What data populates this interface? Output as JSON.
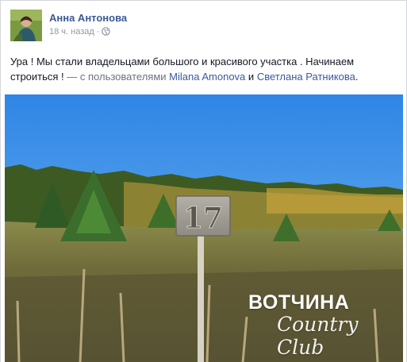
{
  "post": {
    "author": "Анна Антонова",
    "time": "18 ч. назад",
    "privacy_icon": "globe-icon",
    "message": "Ура ! Мы стали владельцами большого и красивого участка . Начинаем строиться !",
    "with_prefix": "— с пользователями",
    "tagged": [
      "Milana Amonova",
      "Светлана Ратникова"
    ],
    "conjunction": "и",
    "end_punct": "."
  },
  "photo": {
    "sign_number": "17",
    "watermark_title": "ВОТЧИНА",
    "watermark_subtitle": "Country Club"
  },
  "colors": {
    "link": "#3b5998",
    "meta": "#9197a3",
    "text": "#141823",
    "sky": "#2f86e6"
  }
}
